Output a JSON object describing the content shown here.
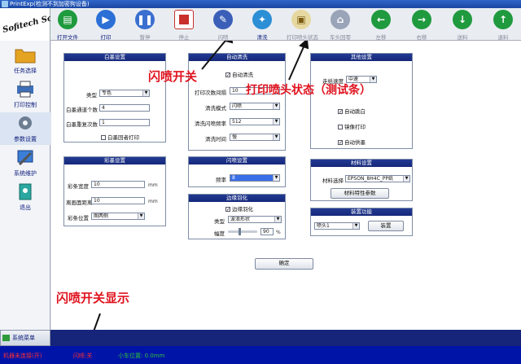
{
  "window": {
    "title": "PrintExp(检测不到加密狗设备)"
  },
  "logo": {
    "text": "Sofitech Software"
  },
  "toolbar": {
    "buttons": [
      {
        "label": "打开文件",
        "icon": "folder-icon",
        "color": "#1f9a3e"
      },
      {
        "label": "打印",
        "icon": "play-icon",
        "color": "#2c6fd6"
      },
      {
        "label": "暂停",
        "icon": "pause-icon",
        "color": "#3a6fd0"
      },
      {
        "label": "停止",
        "icon": "stop-icon",
        "color": "#c8302b"
      },
      {
        "label": "闪喷",
        "icon": "flash-spray-icon",
        "color": "#3b5fb8"
      },
      {
        "label": "清洗",
        "icon": "clean-icon",
        "color": "#2c8fd6"
      },
      {
        "label": "打印喷头状态",
        "icon": "nozzle-status-icon",
        "color": "#b89a3a"
      },
      {
        "label": "车头回零",
        "icon": "home-icon",
        "color": "#9aa4b8"
      },
      {
        "label": "左移",
        "icon": "arrow-left-icon",
        "color": "#1f9a3e"
      },
      {
        "label": "右移",
        "icon": "arrow-right-icon",
        "color": "#1f9a3e"
      },
      {
        "label": "送料",
        "icon": "arrow-down-icon",
        "color": "#1f9a3e"
      },
      {
        "label": "退料",
        "icon": "arrow-up-icon",
        "color": "#1f9a3e"
      }
    ]
  },
  "sidebar": {
    "items": [
      {
        "label": "任务选择",
        "icon": "folder-icon"
      },
      {
        "label": "打印控制",
        "icon": "printer-icon"
      },
      {
        "label": "参数设置",
        "icon": "gear-icon"
      },
      {
        "label": "系统维护",
        "icon": "wrench-icon"
      },
      {
        "label": "退出",
        "icon": "exit-icon"
      }
    ]
  },
  "white": {
    "title": "白墨设置",
    "type_label": "类型",
    "type_value": "专色",
    "channels_label": "白墨通道个数",
    "channels_value": "4",
    "repeat_label": "白墨重复次数",
    "repeat_value": "1",
    "return_label": "白墨回者打印"
  },
  "color": {
    "title": "彩墨设置",
    "width_label": "彩条宽度",
    "width_value": "10",
    "width_unit": "mm",
    "dist_label": "离画面距离",
    "dist_value": "10",
    "dist_unit": "mm",
    "pos_label": "彩条位置",
    "pos_value": "图两侧"
  },
  "clean": {
    "title": "自动清洗",
    "auto_label": "自动清洗",
    "passes_label": "打印次数间隔",
    "passes_value": "10",
    "mode_label": "清洗模式",
    "mode_value": "闪喷",
    "freq_label": "清洗闪喷频率",
    "freq_value": "512",
    "time_label": "清洗时间",
    "time_value": "慢"
  },
  "flash": {
    "title": "闪喷设置",
    "freq_label": "频率",
    "freq_value": "8"
  },
  "feather": {
    "title": "边缘羽化",
    "enable_label": "边缘羽化",
    "type_label": "类型",
    "type_value": "波浪形状",
    "amp_label": "幅度",
    "amp_value": "90",
    "amp_unit": "%",
    "amp_level": 0.4
  },
  "other": {
    "title": "其他设置",
    "speed_label": "走纸速度",
    "speed_value": "中速",
    "auto_white_label": "自动跳白",
    "mirror_label": "镜像打印",
    "auto_feed_label": "自动供墨"
  },
  "material": {
    "title": "材料设置",
    "select_label": "材料选择",
    "select_value": "EPSON_8H4C_PP纸",
    "params_button": "材料特性参数"
  },
  "install": {
    "title": "装置功能",
    "head_value": "喷头1",
    "install_button": "装置"
  },
  "confirm_button": "确定",
  "annotations": {
    "flash_switch": "闪喷开关",
    "nozzle_status": "打印喷头状态（测试条）",
    "flash_display": "闪喷开关显示"
  },
  "system_menu": "系统菜单",
  "status": {
    "left": "机器未连接(开)",
    "flash": "闪喷:关",
    "position": "小车位置: 0.0mm"
  },
  "colors": {
    "annot": "#e0121e",
    "header": "#1c2f86",
    "status_bg": "#0014a8"
  }
}
